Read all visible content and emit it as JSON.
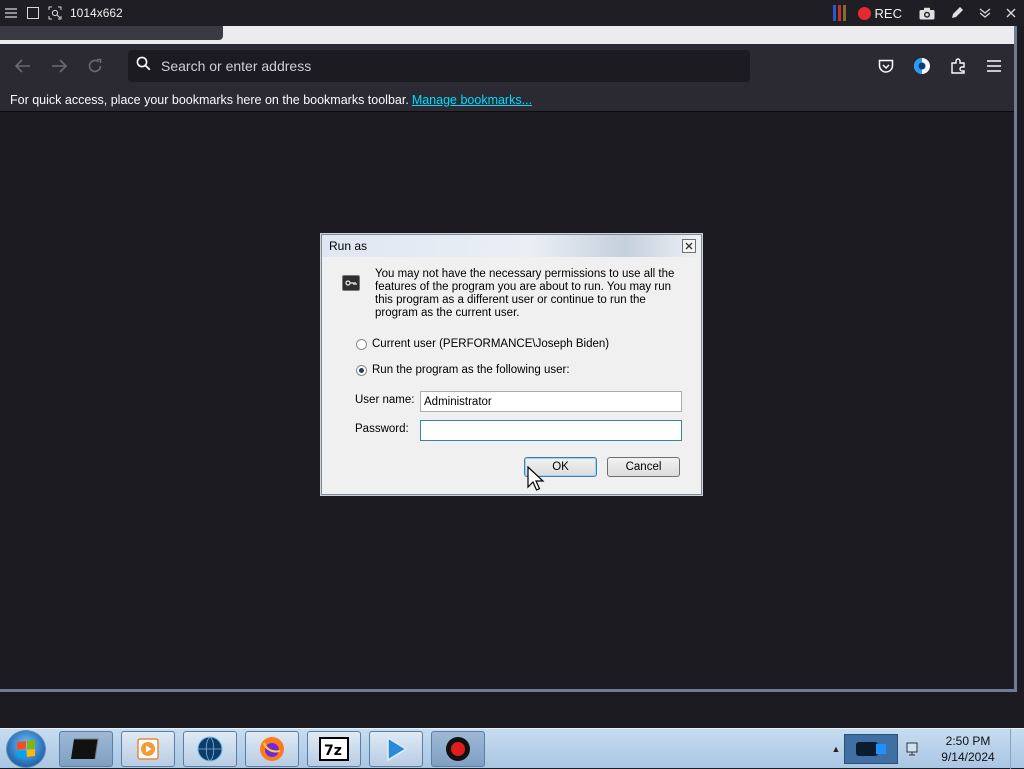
{
  "recorder": {
    "size_label": "1014x662",
    "rec_label": "REC"
  },
  "browser": {
    "address_placeholder": "Search or enter address",
    "bookmarks_message": "For quick access, place your bookmarks here on the bookmarks toolbar.",
    "manage_bookmarks_link": "Manage bookmarks..."
  },
  "dialog": {
    "title": "Run as",
    "message": "You may not have the necessary permissions to use all the features of the program you are about to run. You may run this program as a different user or continue to run the program as the current user.",
    "option_current_user": "Current user (PERFORMANCE\\Joseph Biden)",
    "option_run_as": "Run the program as the following user:",
    "username_label": "User name:",
    "username_value": "Administrator",
    "password_label": "Password:",
    "password_value": "",
    "ok_label": "OK",
    "cancel_label": "Cancel"
  },
  "taskbar": {
    "items": [
      "terminal",
      "media-player",
      "network-globe",
      "firefox",
      "7zip",
      "video-player",
      "recorder"
    ],
    "clock_time": "2:50 PM",
    "clock_date": "9/14/2024"
  },
  "colors": {
    "browser_bg": "#1c1b22",
    "toolbar_bg": "#2b2a33",
    "link": "#00ddff",
    "rec_red": "#e52b2b"
  }
}
